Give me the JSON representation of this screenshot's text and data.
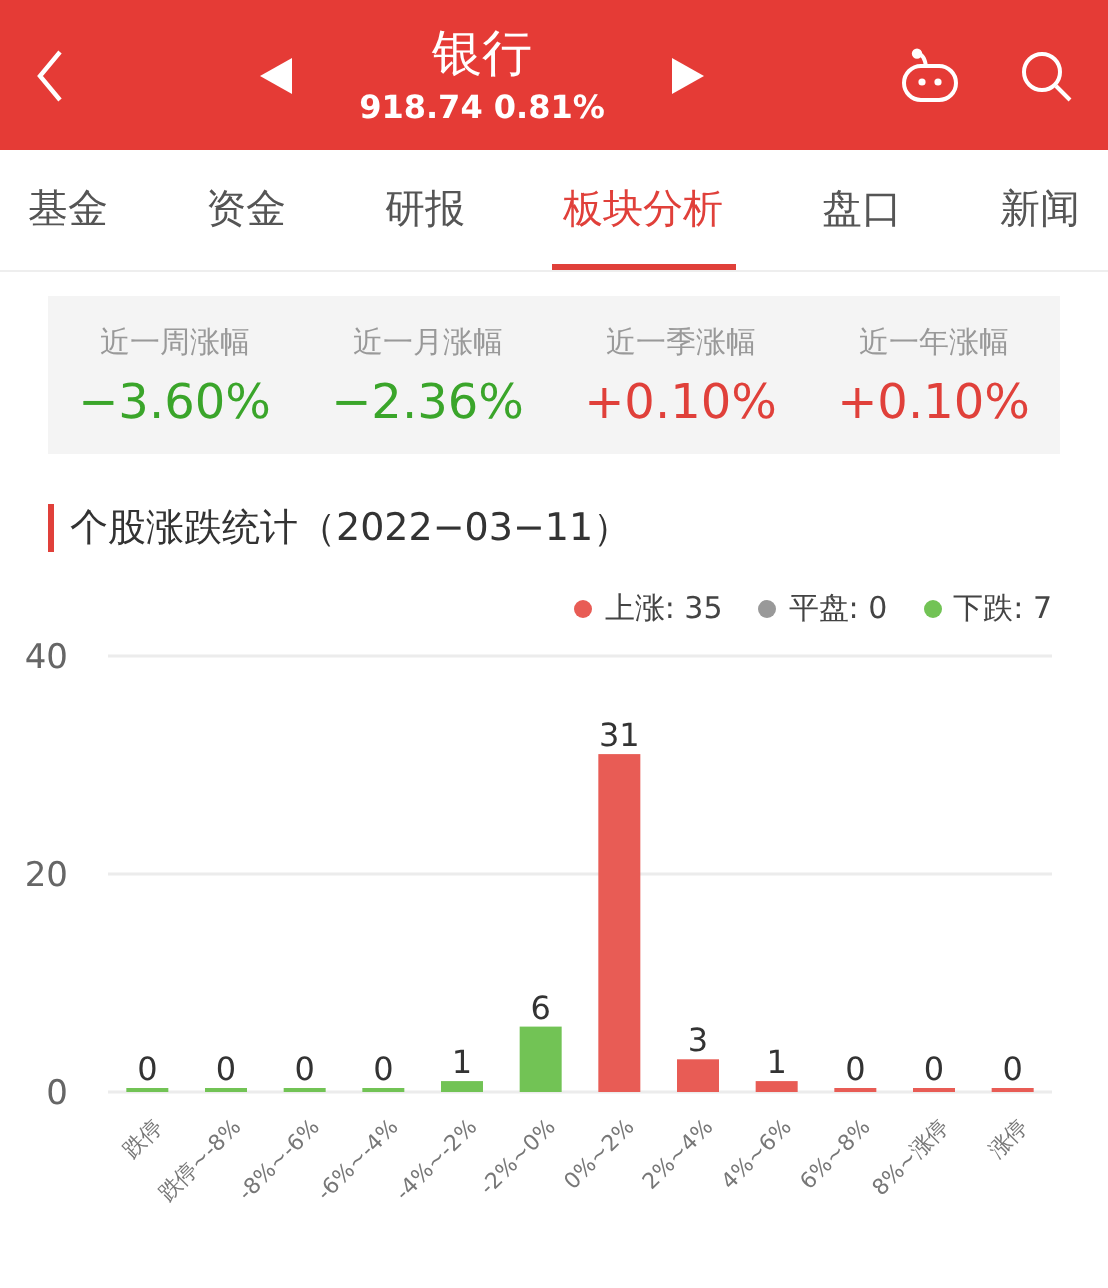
{
  "header": {
    "title": "银行",
    "quote": "918.74 0.81%"
  },
  "tabs": [
    {
      "label": "基金",
      "selected": false
    },
    {
      "label": "资金",
      "selected": false
    },
    {
      "label": "研报",
      "selected": false
    },
    {
      "label": "板块分析",
      "selected": true
    },
    {
      "label": "盘口",
      "selected": false
    },
    {
      "label": "新闻",
      "selected": false
    }
  ],
  "stats": [
    {
      "label": "近一周涨幅",
      "value": "−3.60%",
      "color": "#3aa52a"
    },
    {
      "label": "近一月涨幅",
      "value": "−2.36%",
      "color": "#3aa52a"
    },
    {
      "label": "近一季涨幅",
      "value": "+0.10%",
      "color": "#e0403a"
    },
    {
      "label": "近一年涨幅",
      "value": "+0.10%",
      "color": "#e0403a"
    }
  ],
  "section_title": "个股涨跌统计（2022−03−11）",
  "legend": [
    {
      "label": "上涨: 35",
      "color": "#e85c55"
    },
    {
      "label": "平盘: 0",
      "color": "#999999"
    },
    {
      "label": "下跌: 7",
      "color": "#72c355"
    }
  ],
  "chart_data": {
    "type": "bar",
    "categories": [
      "跌停",
      "跌停~-8%",
      "-8%~-6%",
      "-6%~-4%",
      "-4%~-2%",
      "-2%~0%",
      "0%~2%",
      "2%~4%",
      "4%~6%",
      "6%~8%",
      "8%~涨停",
      "涨停"
    ],
    "series": [
      {
        "color": "#72c355",
        "values": [
          0,
          0,
          0,
          0,
          1,
          6,
          null,
          null,
          null,
          null,
          null,
          null
        ]
      },
      {
        "color": "#e85c55",
        "values": [
          null,
          null,
          null,
          null,
          null,
          null,
          31,
          3,
          1,
          0,
          0,
          0
        ]
      }
    ],
    "ylim": [
      0,
      40
    ],
    "yticks": [
      0,
      20,
      40
    ],
    "data_labels": true
  }
}
